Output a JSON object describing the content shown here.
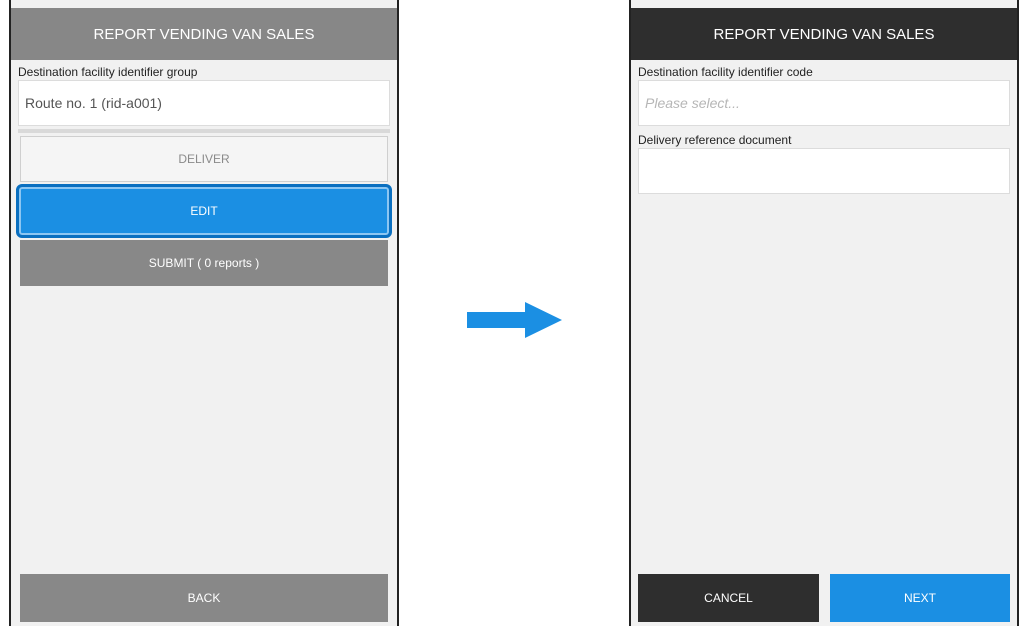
{
  "left_screen": {
    "title": "REPORT VENDING VAN SALES",
    "group_label": "Destination facility identifier group",
    "group_value": "Route no. 1 (rid-a001)",
    "deliver_label": "DELIVER",
    "edit_label": "EDIT",
    "submit_label": "SUBMIT ( 0 reports )",
    "back_label": "BACK"
  },
  "right_screen": {
    "title": "REPORT VENDING VAN SALES",
    "code_label": "Destination facility identifier code",
    "code_placeholder": "Please select...",
    "doc_label": "Delivery reference document",
    "doc_value": "",
    "cancel_label": "CANCEL",
    "next_label": "NEXT"
  },
  "transition_arrow": {
    "icon": "arrow-right-icon",
    "color": "#1b8fe3"
  },
  "colors": {
    "accent": "#1b8fe3",
    "dark": "#2e2e2e",
    "gray": "#888888"
  }
}
